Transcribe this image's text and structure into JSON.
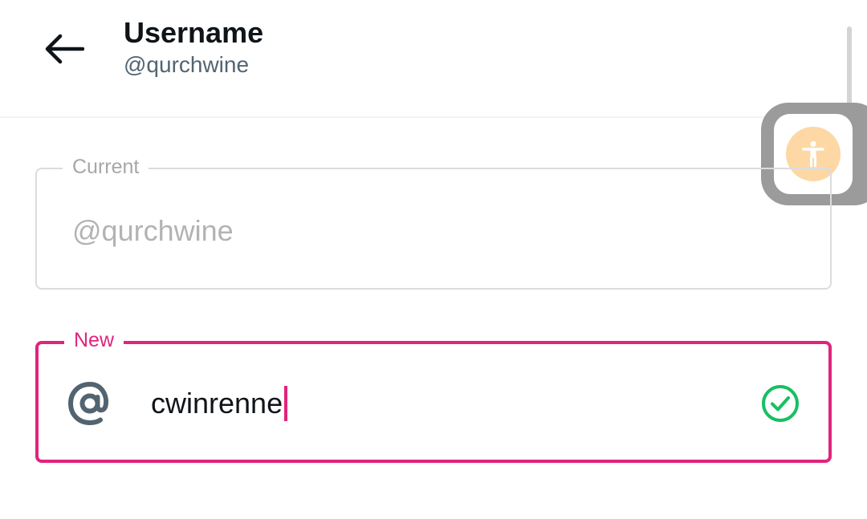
{
  "header": {
    "title": "Username",
    "handle": "@qurchwine"
  },
  "fields": {
    "current": {
      "label": "Current",
      "value": "@qurchwine"
    },
    "new": {
      "label": "New",
      "value": "cwinrenne",
      "status": "valid"
    }
  },
  "icons": {
    "back": "arrow-left-icon",
    "accessibility": "accessibility-person-icon",
    "at": "at-sign-icon",
    "check": "check-circle-icon"
  },
  "colors": {
    "accent": "#e0247d",
    "valid": "#17bf63",
    "muted_text": "#536471",
    "accessibility_bg": "#fdd8a4"
  }
}
